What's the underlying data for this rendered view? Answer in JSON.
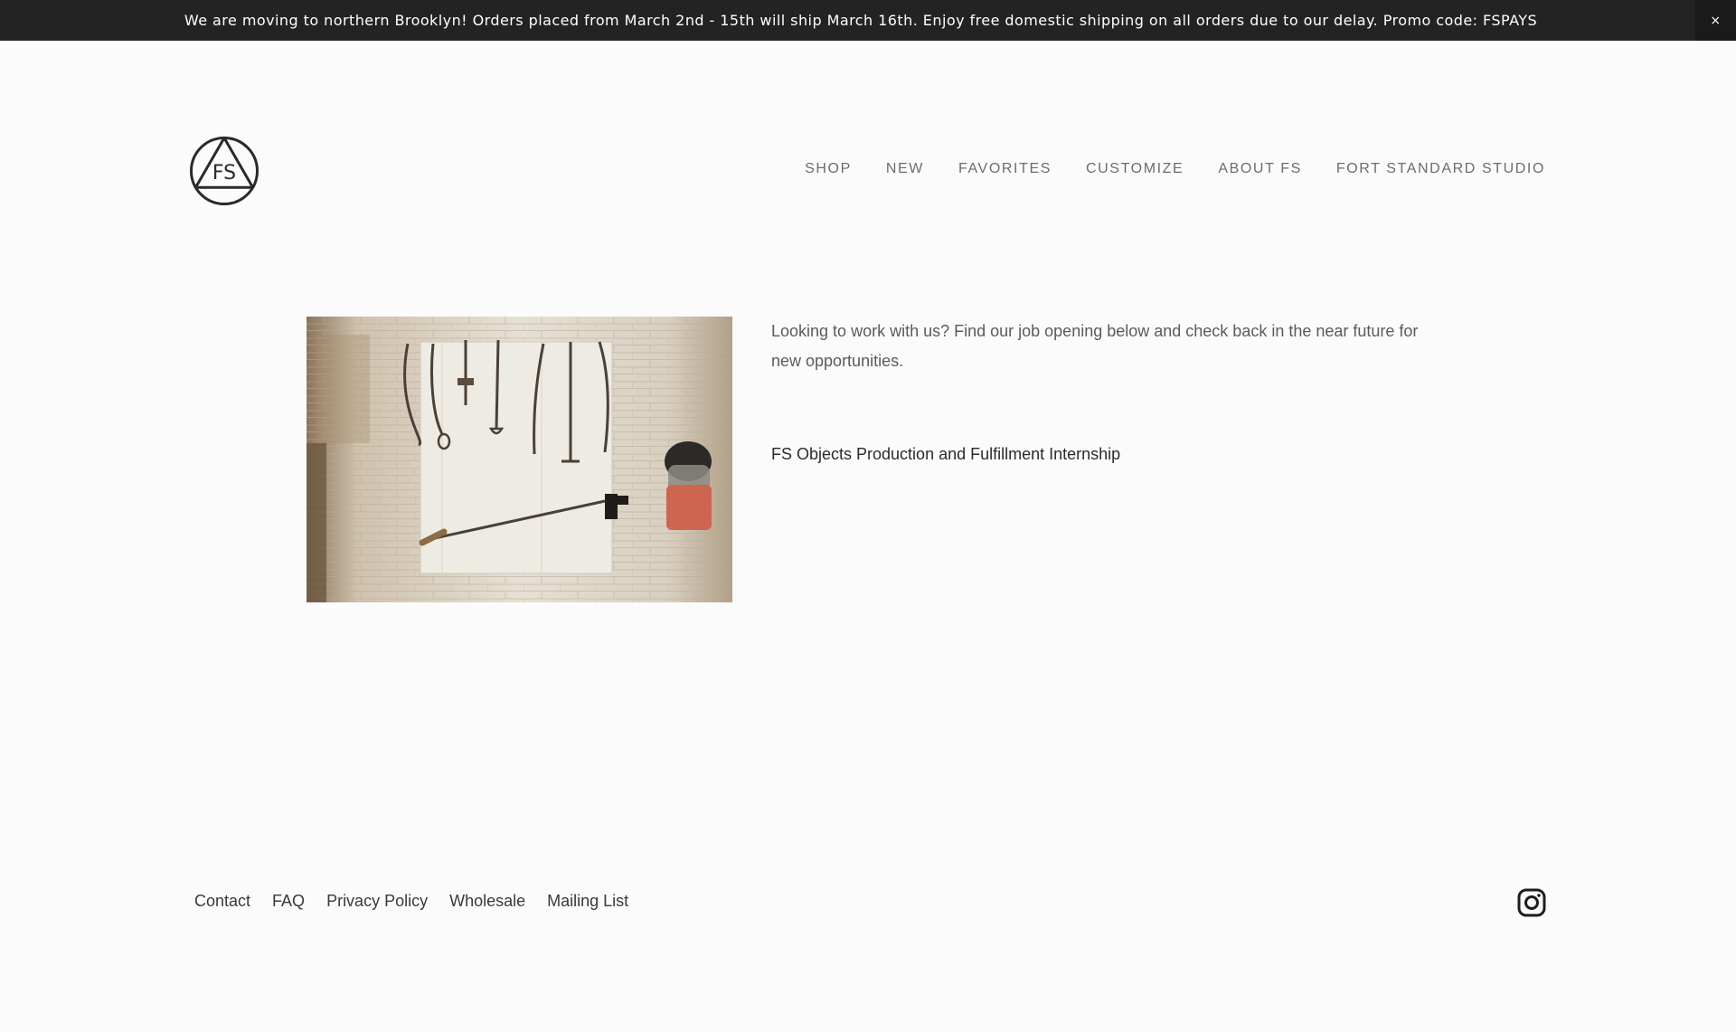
{
  "announcement": {
    "text": "We are moving to northern Brooklyn!  Orders placed from March 2nd - 15th will ship March 16th.  Enjoy free domestic shipping on all orders due to our delay.  Promo code: FSPAYS",
    "close_label": "×"
  },
  "logo": {
    "monogram": "FS"
  },
  "nav": {
    "items": [
      "SHOP",
      "NEW",
      "FAVORITES",
      "CUSTOMIZE",
      "ABOUT FS",
      "FORT STANDARD STUDIO"
    ]
  },
  "main": {
    "intro": "Looking to work with us?  Find our job opening below and check back in the near future for new opportunities.",
    "job_link": "FS Objects Production and Fulfillment Internship"
  },
  "footer": {
    "links": [
      "Contact",
      "FAQ",
      "Privacy Policy",
      "Wholesale",
      "Mailing List"
    ],
    "social_icon": "instagram-icon"
  },
  "colors": {
    "announcement_bg": "#232323",
    "page_bg": "#fbfbfb",
    "nav_text": "#6d6d6d"
  }
}
